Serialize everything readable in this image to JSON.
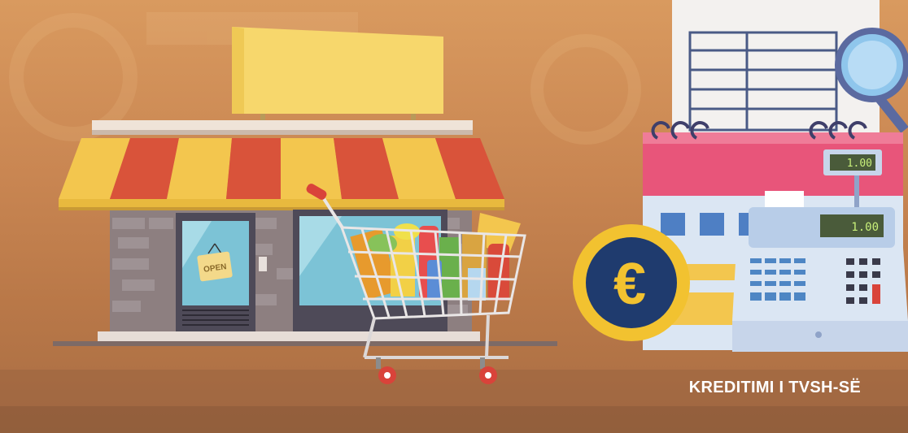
{
  "illustration": {
    "caption": "KREDITIMI I TVSH-SË",
    "door_sign": "OPEN",
    "register_display_top": "1.00",
    "register_display_main": "1.00",
    "currency_symbol": "€"
  },
  "colors": {
    "background": "#c98652",
    "awning_yellow": "#f3c64e",
    "awning_red": "#d9533a",
    "calendar_pink": "#e8557a",
    "coin_yellow": "#f2c230",
    "coin_navy": "#1f3b6e",
    "register_blue": "#b8cde8"
  }
}
